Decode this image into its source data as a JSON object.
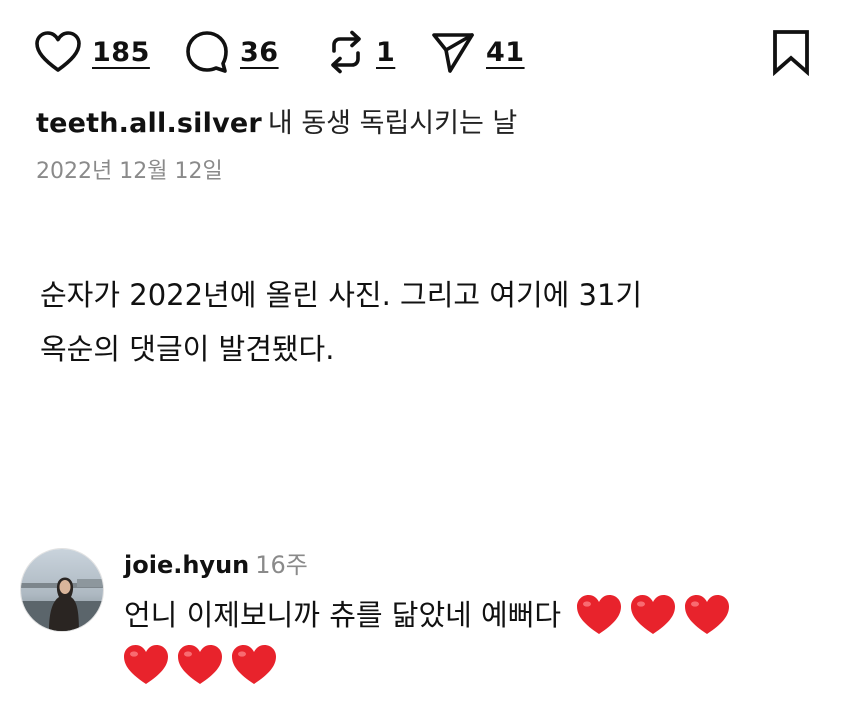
{
  "actions": {
    "likes": "185",
    "comments": "36",
    "reposts": "1",
    "shares": "41",
    "icons": [
      "heart-outline-icon",
      "comment-bubble-icon",
      "repost-icon",
      "send-icon",
      "bookmark-icon"
    ]
  },
  "post": {
    "username": "teeth.all.silver",
    "caption": "내 동생 독립시키는 날",
    "date": "2022년 12월 12일"
  },
  "body": {
    "line1": "순자가 2022년에 올린 사진. 그리고 여기에 31기",
    "line2": "옥순의 댓글이 발견됐다."
  },
  "comment": {
    "username": "joie.hyun",
    "age": "16주",
    "text": "언니 이제보니까 츄를 닮았네 예뻐다",
    "emoji": "❤️",
    "heart_color": "#e8232c"
  }
}
